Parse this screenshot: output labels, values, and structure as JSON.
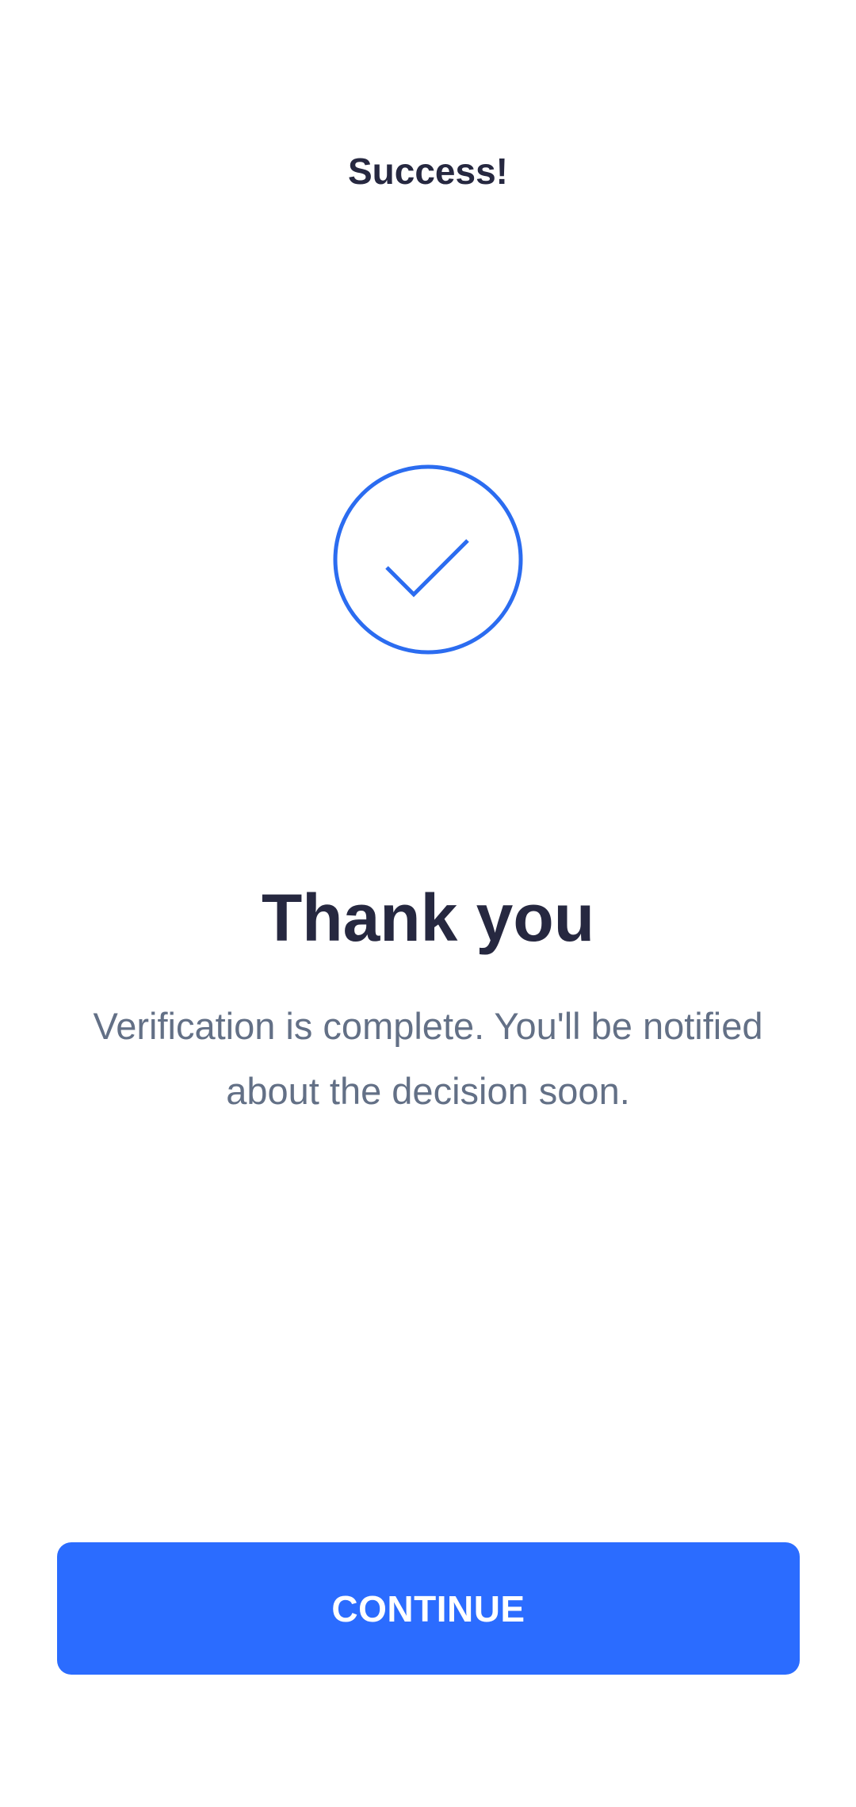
{
  "header": {
    "title": "Success!"
  },
  "status_icon": {
    "name": "checkmark-circle-icon",
    "color": "#2b6cf0"
  },
  "main": {
    "title": "Thank you",
    "description": "Verification is complete. You'll be notified about the decision soon."
  },
  "actions": {
    "continue_label": "CONTINUE"
  },
  "colors": {
    "primary": "#2b6cff",
    "heading_text": "#262840",
    "body_text": "#637086",
    "background": "#ffffff"
  }
}
